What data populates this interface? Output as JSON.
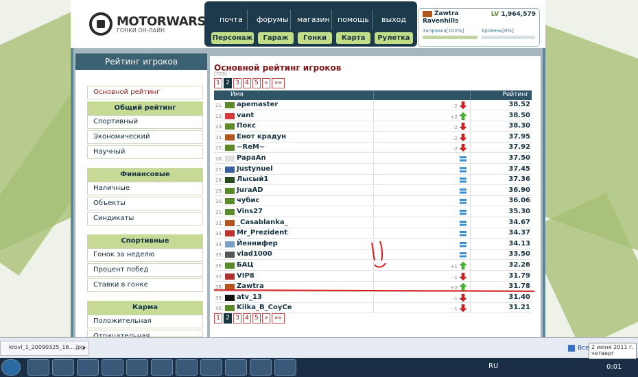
{
  "site": {
    "logo_text": "MOTORWARS.RU",
    "logo_sub": "ГОНКИ ОН-ЛАЙН"
  },
  "top_nav": [
    "почта",
    "форумы",
    "магазин",
    "помощь",
    "выход"
  ],
  "sub_nav": [
    "Персонаж",
    "Гараж",
    "Гонки",
    "Карта",
    "Рулетка"
  ],
  "user": {
    "name": "Zawtra",
    "city": "Ravenhills",
    "lv_label": "LV",
    "lv_value": "1,964,579",
    "fuel_label": "Заправка[100%]",
    "fuel_level": 1.0,
    "level_label": "Уровень[0%]",
    "level_level": 0.0
  },
  "sidebar": {
    "header": "Рейтинг игроков",
    "active": "Основной рейтинг",
    "groups": [
      {
        "title": "Общий рейтинг",
        "items": [
          "Спортивный",
          "Экономический",
          "Научный"
        ]
      },
      {
        "title": "Финансовые",
        "items": [
          "Наличные",
          "Объекты",
          "Синдикаты"
        ]
      },
      {
        "title": "Спортивные",
        "items": [
          "Гонок за неделю",
          "Процент побед",
          "Ставки в гонке"
        ]
      },
      {
        "title": "Карма",
        "items": [
          "Положительная",
          "Отрицательная"
        ]
      }
    ]
  },
  "main": {
    "title": "Основной рейтинг игроков",
    "count": "[723]",
    "pages": [
      "1",
      "2",
      "3",
      "4",
      "5",
      "»",
      "»»"
    ],
    "current_page": "2",
    "col_name": "Имя",
    "col_rating": "Рейтинг"
  },
  "rows": [
    {
      "rank": "21.",
      "name": "apemaster",
      "delta": "-2",
      "dir": "down",
      "score": "38.52",
      "flag": "#5a8a2a"
    },
    {
      "rank": "22.",
      "name": "vant",
      "delta": "+2",
      "dir": "up",
      "score": "38.50",
      "flag": "#d83a3a"
    },
    {
      "rank": "23.",
      "name": "Покс",
      "delta": "-2",
      "dir": "down",
      "score": "38.30",
      "flag": "#5a8a2a"
    },
    {
      "rank": "24.",
      "name": "Енот крадун",
      "delta": "-2",
      "dir": "down",
      "score": "37.95",
      "flag": "#b3551f"
    },
    {
      "rank": "25.",
      "name": "~ReM~",
      "delta": "-2",
      "dir": "down",
      "score": "37.92",
      "flag": "#5a8a2a"
    },
    {
      "rank": "26.",
      "name": "PapaAn",
      "delta": "",
      "dir": "eq",
      "score": "37.50",
      "flag": "#e0e0e0"
    },
    {
      "rank": "27.",
      "name": "Justynuel",
      "delta": "",
      "dir": "eq",
      "score": "37.45",
      "flag": "#3a5fa0"
    },
    {
      "rank": "28.",
      "name": "Лысый1",
      "delta": "",
      "dir": "eq",
      "score": "37.36",
      "flag": "#2c4d20"
    },
    {
      "rank": "29.",
      "name": "JuraAD",
      "delta": "",
      "dir": "eq",
      "score": "36.90",
      "flag": "#5a8a2a"
    },
    {
      "rank": "30.",
      "name": "чубис",
      "delta": "",
      "dir": "eq",
      "score": "36.06",
      "flag": "#5a8a2a"
    },
    {
      "rank": "31.",
      "name": "Vins27",
      "delta": "",
      "dir": "eq",
      "score": "35.30",
      "flag": "#5a8a2a"
    },
    {
      "rank": "32.",
      "name": "_Casablanka_",
      "delta": "",
      "dir": "eq",
      "score": "34.67",
      "flag": "#b3551f"
    },
    {
      "rank": "33.",
      "name": "Mr_Prezident",
      "delta": "",
      "dir": "eq",
      "score": "34.37",
      "flag": "#c03030"
    },
    {
      "rank": "34.",
      "name": "Йеннифер",
      "delta": "",
      "dir": "eq",
      "score": "34.13",
      "flag": "#7aa0c8"
    },
    {
      "rank": "35.",
      "name": "vlad1000",
      "delta": "",
      "dir": "eq",
      "score": "33.50",
      "flag": "#555"
    },
    {
      "rank": "36.",
      "name": "БАЦ",
      "delta": "+1",
      "dir": "up",
      "score": "32.26",
      "flag": "#5a8a2a"
    },
    {
      "rank": "37.",
      "name": "VIP8",
      "delta": "-1",
      "dir": "down",
      "score": "31.79",
      "flag": "#b03030"
    },
    {
      "rank": "38.",
      "name": "Zawtra",
      "delta": "+2",
      "dir": "up",
      "score": "31.78",
      "flag": "#b3551f"
    },
    {
      "rank": "39.",
      "name": "atv_13",
      "delta": "-1",
      "dir": "down",
      "score": "31.40",
      "flag": "#111"
    },
    {
      "rank": "40.",
      "name": "Kilka_B_CoyCe",
      "delta": "-1",
      "dir": "down",
      "score": "31.21",
      "flag": "#5a8a2a"
    }
  ],
  "taskbar": {
    "download_file": "krovl_1_20090325_16....jpg",
    "lang": "RU",
    "time": "0:01",
    "tooltip_date": "2 июня 2011 г.",
    "tooltip_day": "четверг",
    "tooltip_cut": "Все"
  },
  "colors": {
    "accent_dark": "#163342",
    "accent_green": "#c3dc87",
    "title_red": "#7e1a1a",
    "up": "#44b82c",
    "down": "#d62020",
    "eq": "#3d90d0"
  }
}
